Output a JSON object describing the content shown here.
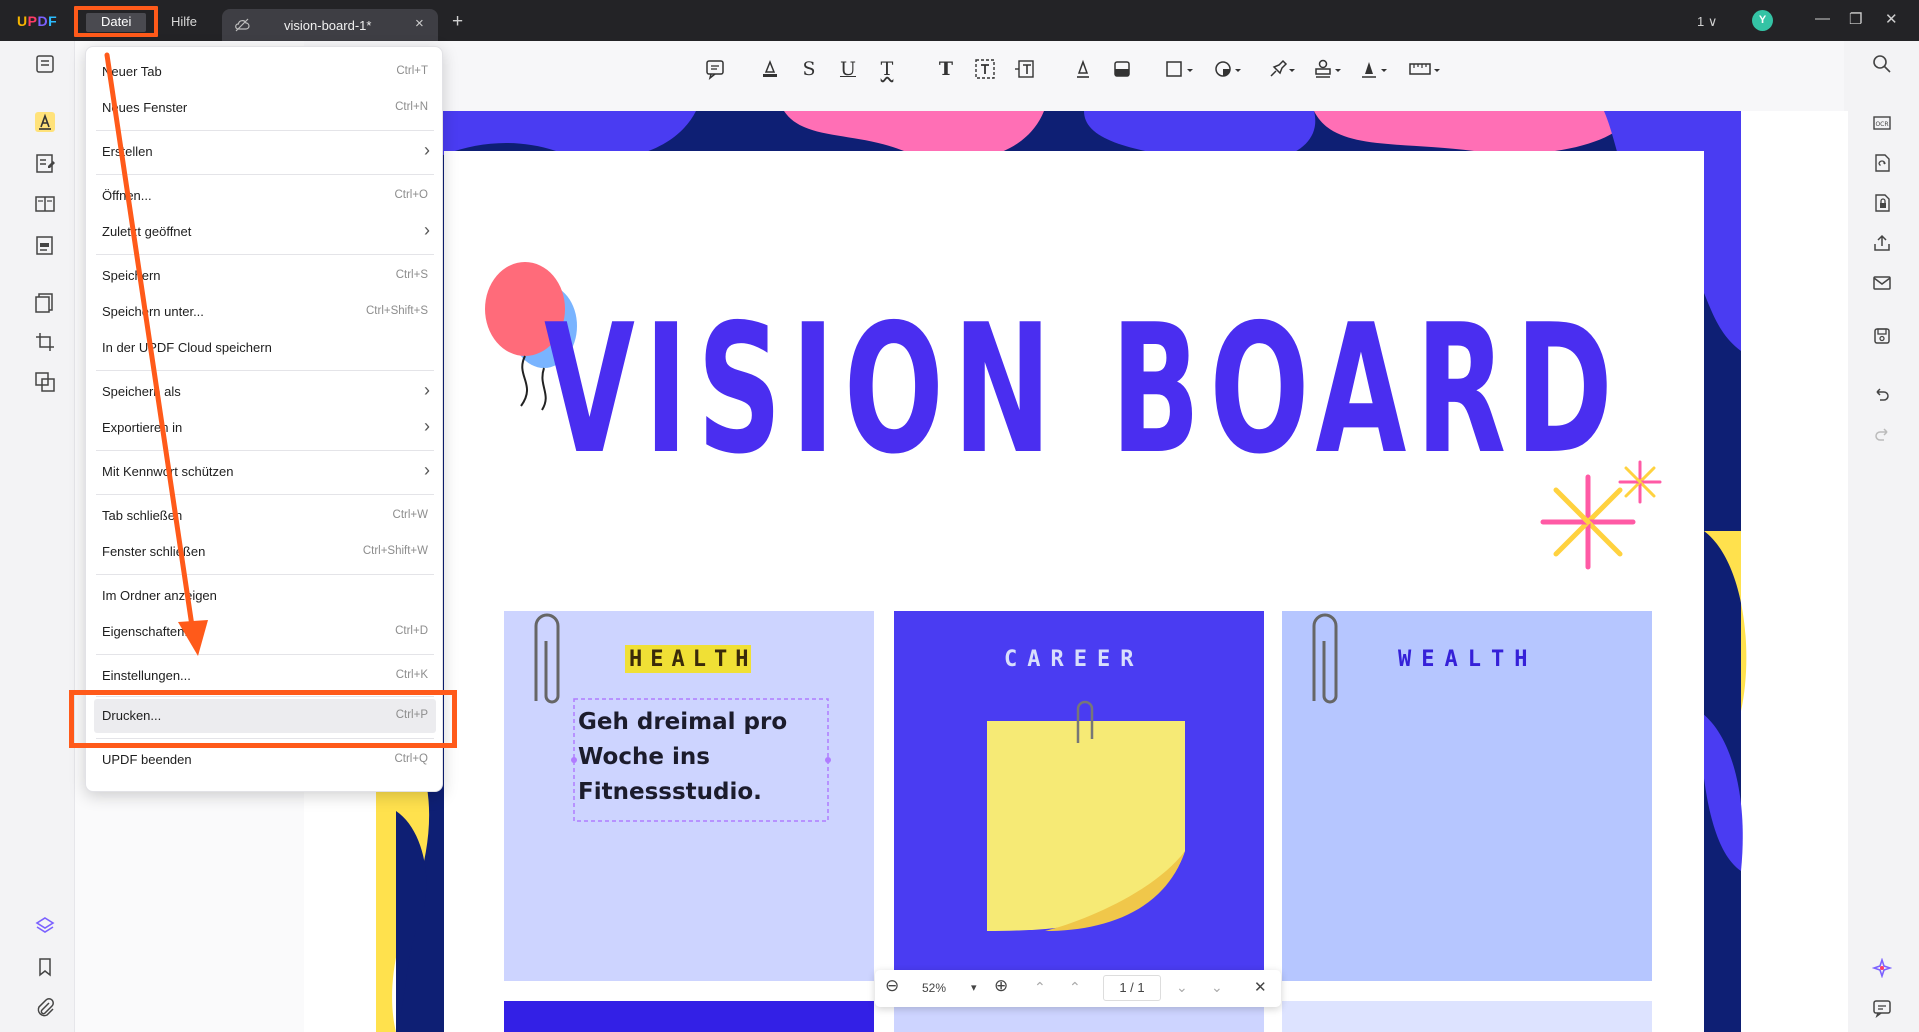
{
  "app": {
    "logo": {
      "u": "U",
      "p": "P",
      "d": "D",
      "f": "F"
    },
    "menus": {
      "datei": "Datei",
      "hilfe": "Hilfe"
    },
    "tab_title": "vision-board-1*",
    "tab_close": "×",
    "new_tab": "+",
    "page_chip": "1 ∨",
    "avatar": "Y",
    "window": {
      "minimize": "—",
      "restore": "❐",
      "close": "✕"
    }
  },
  "file_menu": {
    "items": [
      {
        "label": "Neuer Tab",
        "shortcut": "Ctrl+T"
      },
      {
        "label": "Neues Fenster",
        "shortcut": "Ctrl+N"
      },
      {
        "label": "Erstellen",
        "submenu": true
      },
      {
        "label": "Öffnen...",
        "shortcut": "Ctrl+O"
      },
      {
        "label": "Zuletzt geöffnet",
        "submenu": true
      },
      {
        "label": "Speichern",
        "shortcut": "Ctrl+S"
      },
      {
        "label": "Speichern unter...",
        "shortcut": "Ctrl+Shift+S"
      },
      {
        "label": "In der UPDF Cloud speichern"
      },
      {
        "label": "Speichern als",
        "submenu": true
      },
      {
        "label": "Exportieren in",
        "submenu": true
      },
      {
        "label": "Mit Kennwort schützen",
        "submenu": true
      },
      {
        "label": "Tab schließen",
        "shortcut": "Ctrl+W"
      },
      {
        "label": "Fenster schließen",
        "shortcut": "Ctrl+Shift+W"
      },
      {
        "label": "Im Ordner anzeigen"
      },
      {
        "label": "Eigenschaften...",
        "shortcut": "Ctrl+D"
      },
      {
        "label": "Einstellungen...",
        "shortcut": "Ctrl+K"
      },
      {
        "label": "Drucken...",
        "shortcut": "Ctrl+P"
      },
      {
        "label": "UPDF beenden",
        "shortcut": "Ctrl+Q"
      }
    ],
    "submenu_arrow": "›"
  },
  "document": {
    "title": "VISION BOARD",
    "cards": [
      {
        "label": "HEALTH",
        "note": "Geh dreimal pro Woche ins Fitnessstudio."
      },
      {
        "label": "CAREER"
      },
      {
        "label": "WEALTH"
      }
    ]
  },
  "zoom_bar": {
    "zoom_out": "⊖",
    "zoom_level": "52%",
    "zoom_dropdown": "▾",
    "zoom_in": "⊕",
    "first": "⌃",
    "prev": "⌃",
    "page": "1 / 1",
    "next": "⌄",
    "last": "⌄",
    "close": "✕"
  },
  "toolbar_glyphs": {
    "strike": "S",
    "underline": "U",
    "squiggly": "T",
    "text": "T"
  },
  "colors": {
    "accent": "#ff5a1a",
    "title_blue": "#4a2ef0",
    "page_navy": "#0e1f74",
    "card_health": "#cdd4ff",
    "card_career": "#4a3cf2",
    "card_wealth": "#b6c6ff"
  }
}
